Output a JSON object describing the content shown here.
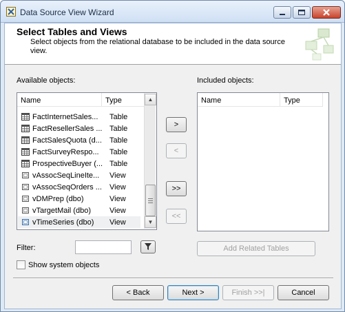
{
  "window": {
    "title": "Data Source View Wizard"
  },
  "header": {
    "title": "Select Tables and Views",
    "description": "Select objects from the relational database to be included in the data source view."
  },
  "available": {
    "label": "Available objects:",
    "columns": {
      "name": "Name",
      "type": "Type"
    },
    "rows": [
      {
        "name": "FactInternetSales...",
        "type": "Table",
        "icon": "table-icon"
      },
      {
        "name": "FactResellerSales ...",
        "type": "Table",
        "icon": "table-icon"
      },
      {
        "name": "FactSalesQuota (d...",
        "type": "Table",
        "icon": "table-icon"
      },
      {
        "name": "FactSurveyRespo...",
        "type": "Table",
        "icon": "table-icon"
      },
      {
        "name": "ProspectiveBuyer (...",
        "type": "Table",
        "icon": "table-icon"
      },
      {
        "name": "vAssocSeqLineIte...",
        "type": "View",
        "icon": "view-icon"
      },
      {
        "name": "vAssocSeqOrders ...",
        "type": "View",
        "icon": "view-icon"
      },
      {
        "name": "vDMPrep (dbo)",
        "type": "View",
        "icon": "view-icon"
      },
      {
        "name": "vTargetMail (dbo)",
        "type": "View",
        "icon": "view-icon"
      },
      {
        "name": "vTimeSeries (dbo)",
        "type": "View",
        "icon": "view-icon"
      }
    ]
  },
  "included": {
    "label": "Included objects:",
    "columns": {
      "name": "Name",
      "type": "Type"
    }
  },
  "transfer": {
    "add": ">",
    "remove": "<",
    "add_all": ">>",
    "remove_all": "<<"
  },
  "filter": {
    "label": "Filter:",
    "value": ""
  },
  "add_related_label": "Add Related Tables",
  "show_system_label": "Show system objects",
  "show_system_checked": false,
  "footer": {
    "back": "< Back",
    "next": "Next >",
    "finish": "Finish >>|",
    "cancel": "Cancel"
  },
  "colors": {
    "accent": "#3c7fb1",
    "selection": "#eef0f1"
  }
}
